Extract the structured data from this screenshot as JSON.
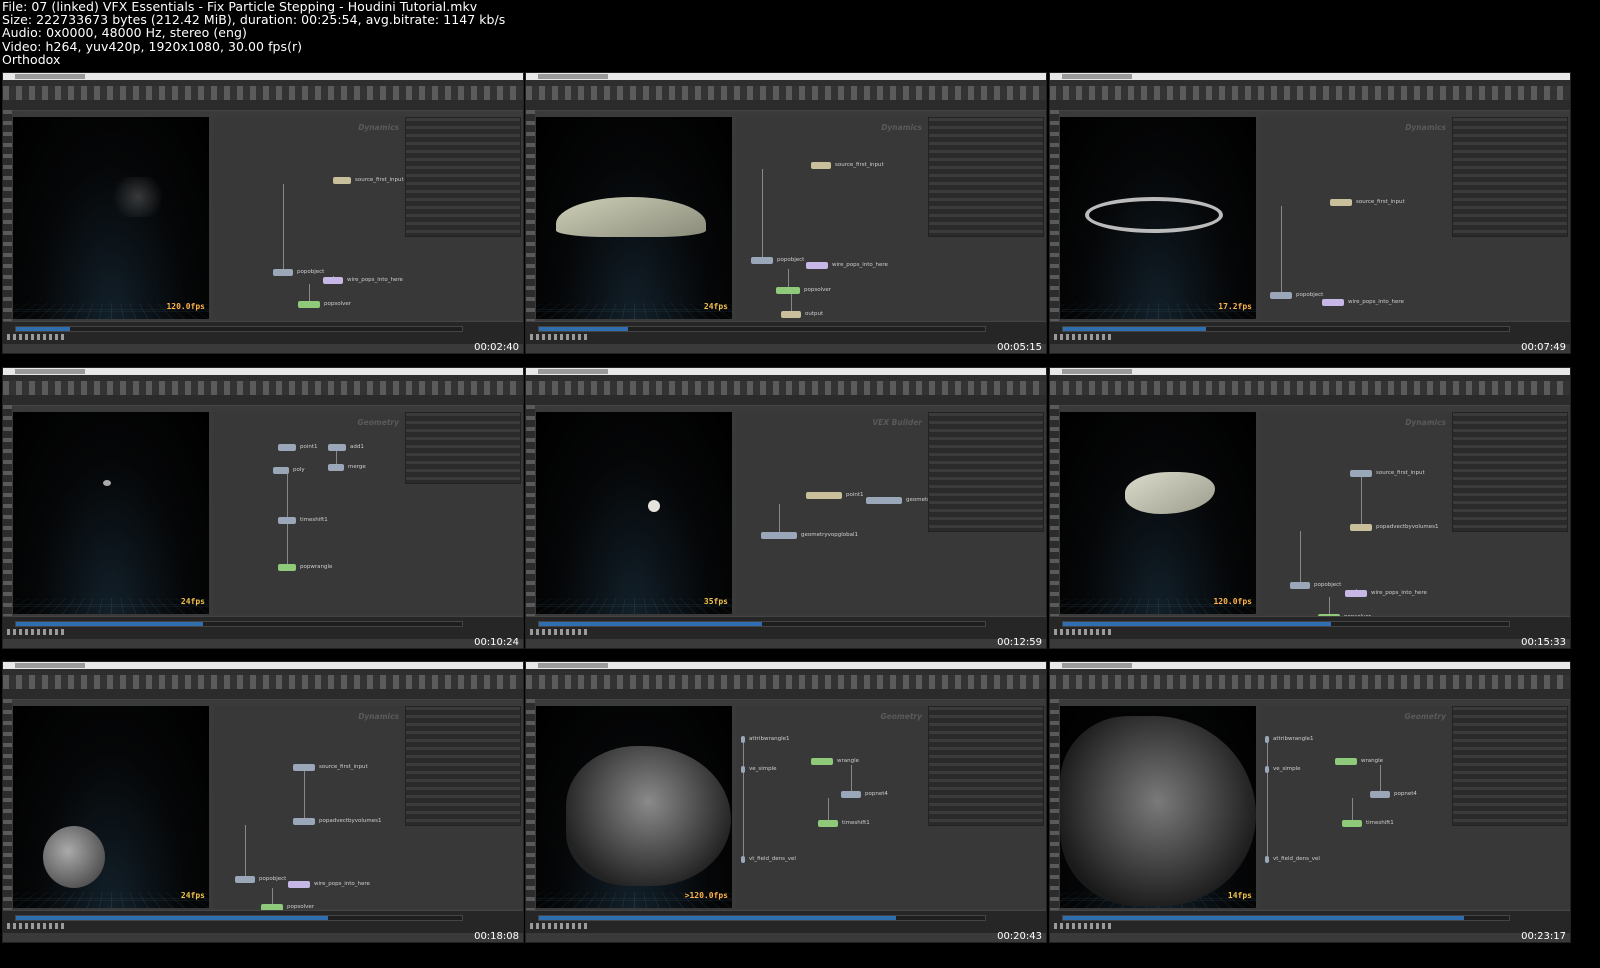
{
  "header": {
    "file": "File: 07 (linked) VFX Essentials - Fix Particle Stepping - Houdini Tutorial.mkv",
    "size": "Size: 222733673 bytes (212.42 MiB), duration: 00:25:54, avg.bitrate: 1147 kb/s",
    "audio": "Audio: 0x0000, 48000 Hz, stereo (eng)",
    "video": "Video: h264, yuv420p, 1920x1080, 30.00 fps(r)",
    "author": "Orthodox"
  },
  "thumbnails": [
    {
      "timestamp": "00:02:40",
      "context": "Dynamics",
      "fps": "120.0fps",
      "nodes": [
        "source_first_input",
        "popobject",
        "wire_pops_into_here",
        "popsolver"
      ]
    },
    {
      "timestamp": "00:05:15",
      "context": "Dynamics",
      "fps": "24fps",
      "nodes": [
        "source_first_input",
        "popobject",
        "wire_pops_into_here",
        "popsolver",
        "output"
      ]
    },
    {
      "timestamp": "00:07:49",
      "context": "Dynamics",
      "fps": "17.2fps",
      "nodes": [
        "source_first_input",
        "popobject",
        "wire_pops_into_here"
      ]
    },
    {
      "timestamp": "00:10:24",
      "context": "Geometry",
      "fps": "24fps",
      "nodes": [
        "point1",
        "add1",
        "merge",
        "poly",
        "timeshift1",
        "popwrangle"
      ]
    },
    {
      "timestamp": "00:12:59",
      "context": "VEX Builder",
      "fps": "35fps",
      "nodes": [
        "point1",
        "geometryvopoutput1",
        "geometryvopglobal1"
      ]
    },
    {
      "timestamp": "00:15:33",
      "context": "Dynamics",
      "fps": "120.0fps",
      "nodes": [
        "source_first_input",
        "popadvectbyvolumes1",
        "popobject",
        "wire_pops_into_here",
        "popsolver"
      ]
    },
    {
      "timestamp": "00:18:08",
      "context": "Dynamics",
      "fps": "24fps",
      "nodes": [
        "source_first_input",
        "popadvectbyvolumes1",
        "popobject",
        "wire_pops_into_here",
        "popsolver"
      ]
    },
    {
      "timestamp": "00:20:43",
      "context": "Geometry",
      "fps": ">120.0fps",
      "nodes": [
        "wrangle",
        "popnet4",
        "timeshift1",
        "attribwrangle1",
        "ve_simple",
        "vt_field_dens_vel"
      ]
    },
    {
      "timestamp": "00:23:17",
      "context": "Geometry",
      "fps": "14fps",
      "nodes": [
        "wrangle",
        "popnet4",
        "timeshift1",
        "attribwrangle1",
        "ve_simple",
        "vt_field_dens_vel"
      ]
    }
  ],
  "colors": {
    "pop_node": "#8fc97a",
    "source_node": "#c9bf9a",
    "object_node": "#9aa7b8",
    "wire_node": "#c6b7e6",
    "timeline_fill": "#2f6fb0"
  }
}
